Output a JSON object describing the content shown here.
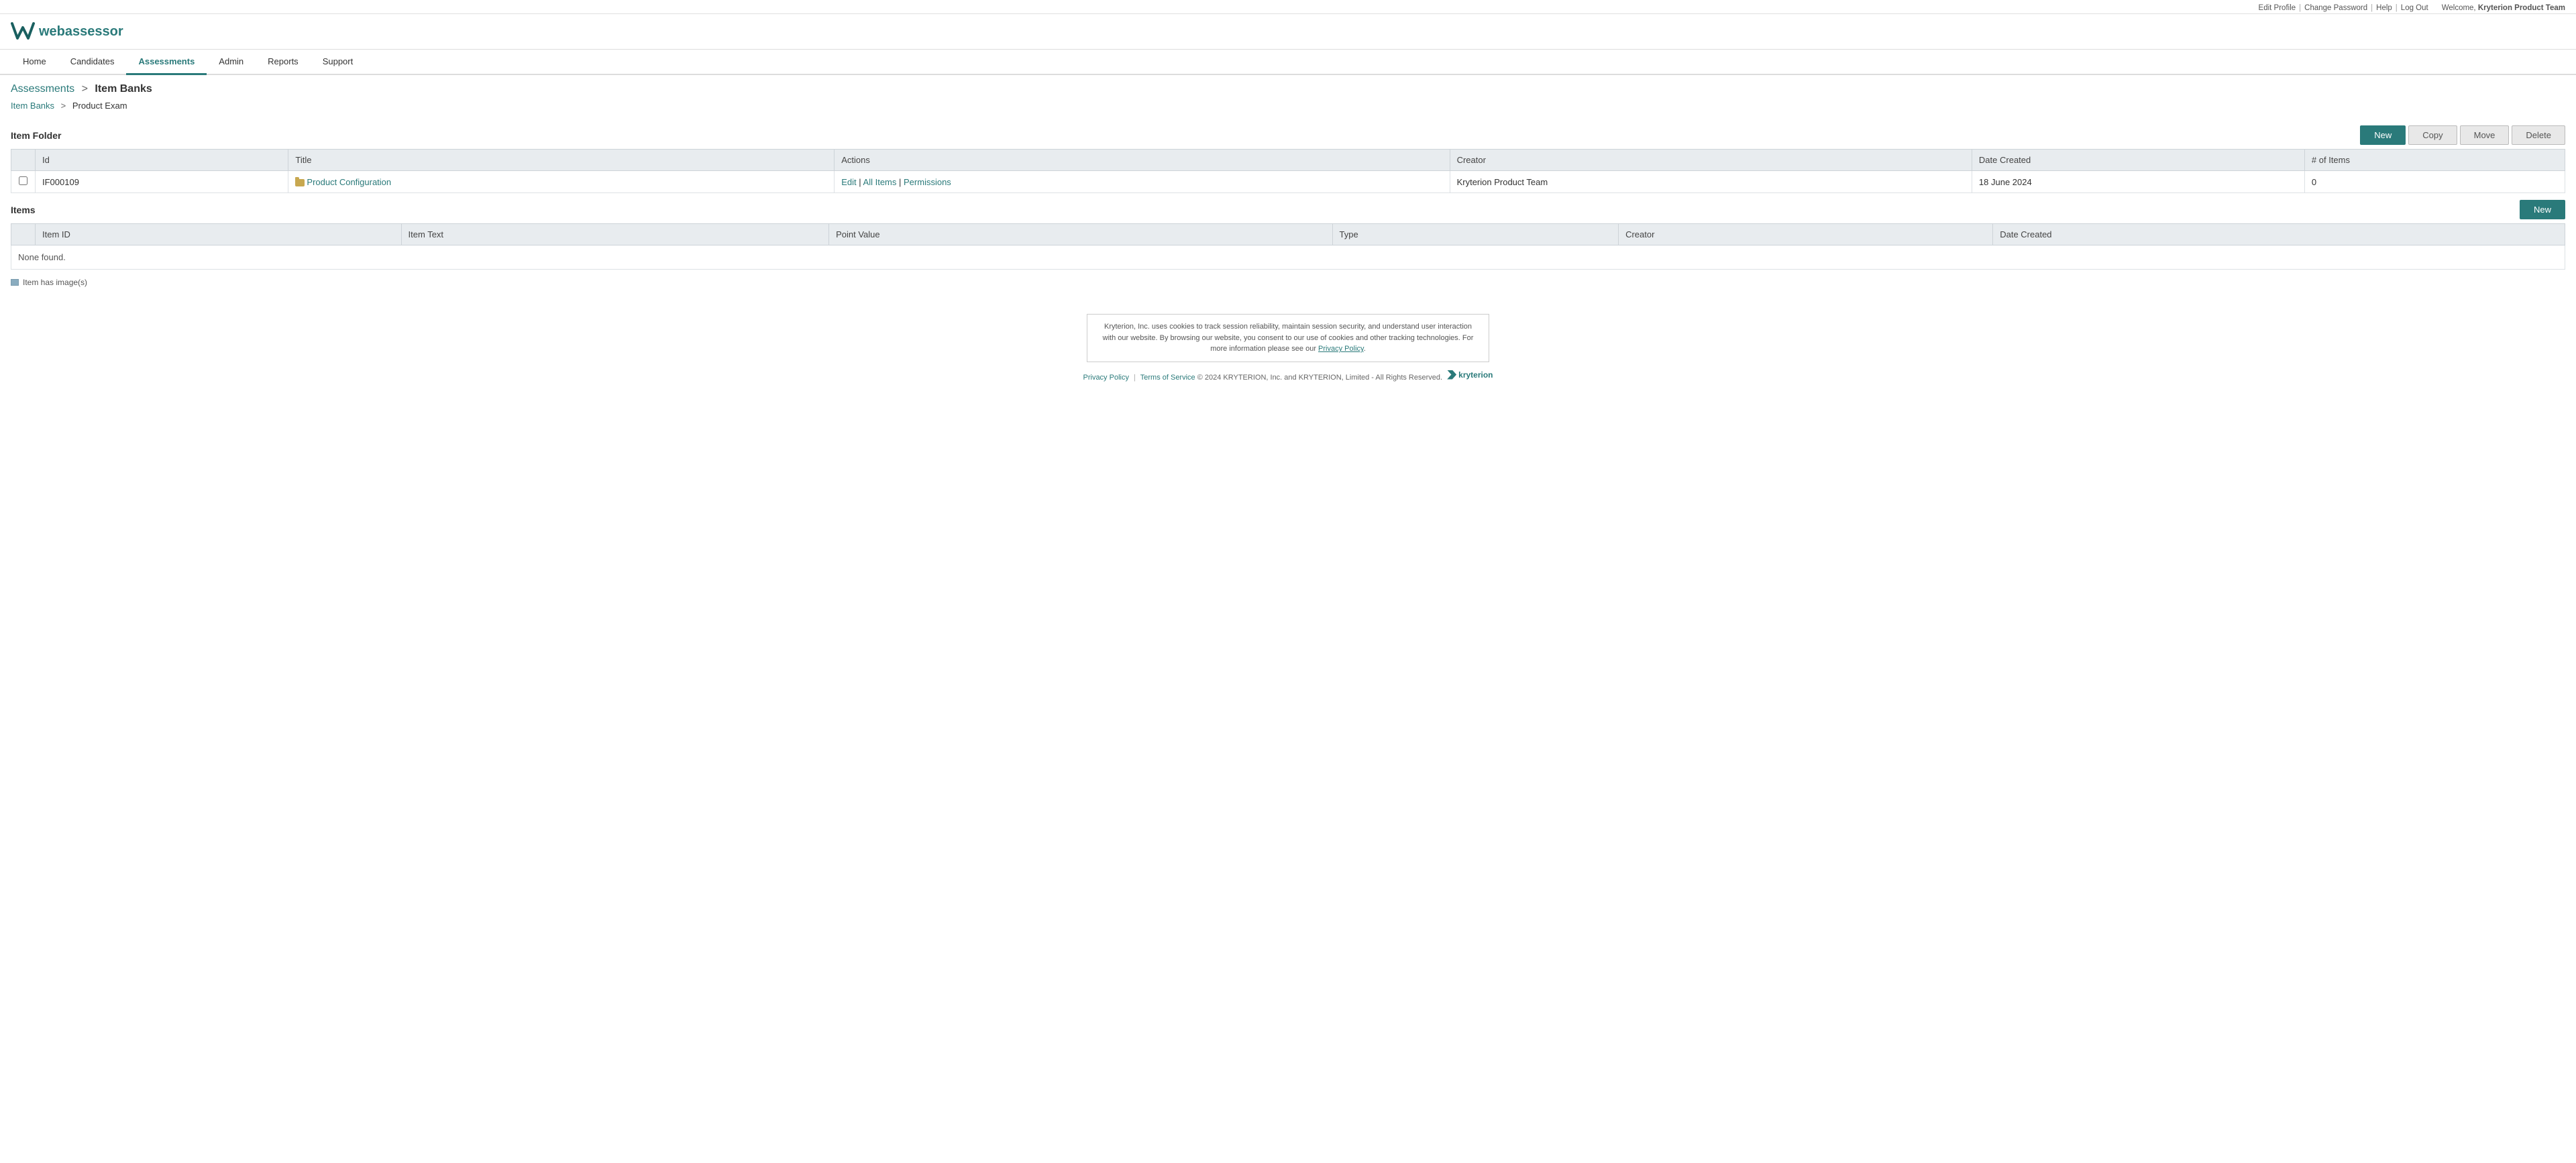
{
  "topbar": {
    "edit_profile": "Edit Profile",
    "change_password": "Change Password",
    "help": "Help",
    "log_out": "Log Out",
    "welcome_text": "Welcome,",
    "user_name": "Kryterion Product Team"
  },
  "logo": {
    "text": "webassessor"
  },
  "nav": {
    "items": [
      {
        "label": "Home",
        "active": false
      },
      {
        "label": "Candidates",
        "active": false
      },
      {
        "label": "Assessments",
        "active": true
      },
      {
        "label": "Admin",
        "active": false
      },
      {
        "label": "Reports",
        "active": false
      },
      {
        "label": "Support",
        "active": false
      }
    ]
  },
  "breadcrumb": {
    "part1": "Assessments",
    "sep": ">",
    "part2": "Item Banks"
  },
  "sub_breadcrumb": {
    "part1": "Item Banks",
    "sep": ">",
    "part2": "Product Exam"
  },
  "item_folder_section": {
    "title": "Item Folder",
    "buttons": {
      "new": "New",
      "copy": "Copy",
      "move": "Move",
      "delete": "Delete"
    },
    "table": {
      "headers": [
        "Id",
        "Title",
        "Actions",
        "Creator",
        "Date Created",
        "# of Items"
      ],
      "rows": [
        {
          "id": "IF000109",
          "title": "Product Configuration",
          "has_folder_icon": true,
          "actions": [
            "Edit",
            "All Items",
            "Permissions"
          ],
          "creator": "Kryterion Product Team",
          "date_created": "18 June 2024",
          "num_items": "0"
        }
      ]
    }
  },
  "items_section": {
    "title": "Items",
    "buttons": {
      "new": "New"
    },
    "table": {
      "headers": [
        "Item ID",
        "Item Text",
        "Point Value",
        "Type",
        "Creator",
        "Date Created"
      ]
    },
    "none_found": "None found.",
    "legend": {
      "icon_label": "Item has image(s)"
    }
  },
  "footer": {
    "cookie_text": "Kryterion, Inc. uses cookies to track session reliability, maintain session security, and understand user interaction with our website. By browsing our website, you consent to our use of cookies and other tracking technologies. For more information please see our",
    "privacy_policy_link": "Privacy Policy",
    "cookie_end": ".",
    "links": {
      "privacy_policy": "Privacy Policy",
      "terms_of_service": "Terms of Service",
      "copyright": "© 2024  KRYTERION, Inc. and KRYTERION, Limited - All Rights Reserved.",
      "brand": "kryterion"
    }
  }
}
